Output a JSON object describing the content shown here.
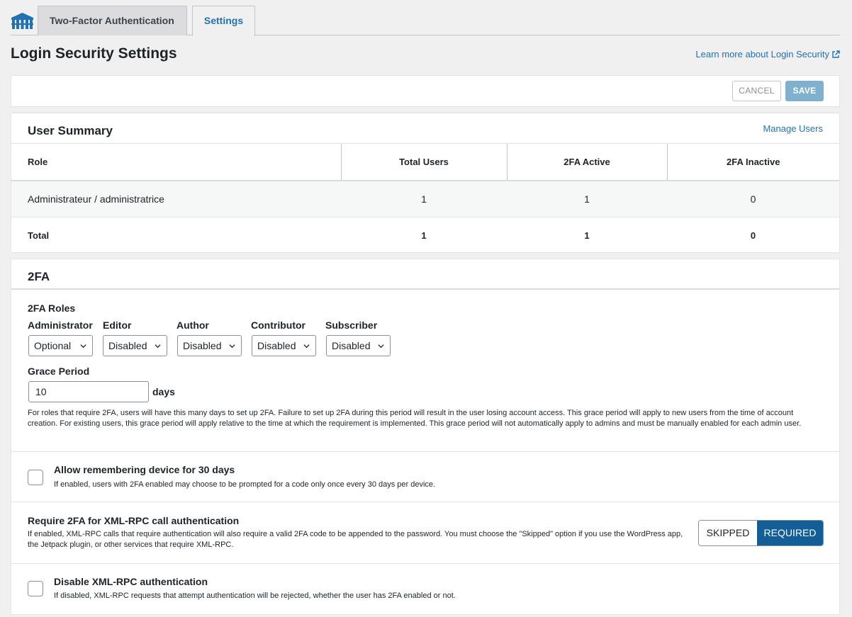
{
  "tabs": [
    {
      "label": "Two-Factor Authentication"
    },
    {
      "label": "Settings"
    }
  ],
  "page_title": "Login Security Settings",
  "learn_more": "Learn more about Login Security",
  "actions": {
    "cancel": "CANCEL",
    "save": "SAVE"
  },
  "user_summary": {
    "title": "User Summary",
    "manage": "Manage Users",
    "columns": [
      "Role",
      "Total Users",
      "2FA Active",
      "2FA Inactive"
    ],
    "rows": [
      [
        "Administrateur / administratrice",
        "1",
        "1",
        "0"
      ]
    ],
    "total": [
      "Total",
      "1",
      "1",
      "0"
    ]
  },
  "twofa": {
    "title": "2FA",
    "roles_label": "2FA Roles",
    "roles": [
      {
        "name": "Administrator",
        "value": "Optional"
      },
      {
        "name": "Editor",
        "value": "Disabled"
      },
      {
        "name": "Author",
        "value": "Disabled"
      },
      {
        "name": "Contributor",
        "value": "Disabled"
      },
      {
        "name": "Subscriber",
        "value": "Disabled"
      }
    ],
    "grace_label": "Grace Period",
    "grace_value": "10",
    "grace_unit": "days",
    "grace_help": "For roles that require 2FA, users will have this many days to set up 2FA. Failure to set up 2FA during this period will result in the user losing account access. This grace period will apply to new users from the time of account creation. For existing users, this grace period will apply relative to the time at which the requirement is implemented. This grace period will not automatically apply to admins and must be manually enabled for each admin user.",
    "remember_title": "Allow remembering device for 30 days",
    "remember_help": "If enabled, users with 2FA enabled may choose to be prompted for a code only once every 30 days per device.",
    "xmlrpc_title": "Require 2FA for XML-RPC call authentication",
    "xmlrpc_help": "If enabled, XML-RPC calls that require authentication will also require a valid 2FA code to be appended to the password. You must choose the \"Skipped\" option if you use the WordPress app, the Jetpack plugin, or other services that require XML-RPC.",
    "xmlrpc_options": {
      "skipped": "SKIPPED",
      "required": "REQUIRED",
      "selected": "REQUIRED"
    },
    "disable_title": "Disable XML-RPC authentication",
    "disable_help": "If disabled, XML-RPC requests that attempt authentication will be rejected, whether the user has 2FA enabled or not."
  },
  "colors": {
    "accent": "#2271b1",
    "selected": "#135e96"
  }
}
